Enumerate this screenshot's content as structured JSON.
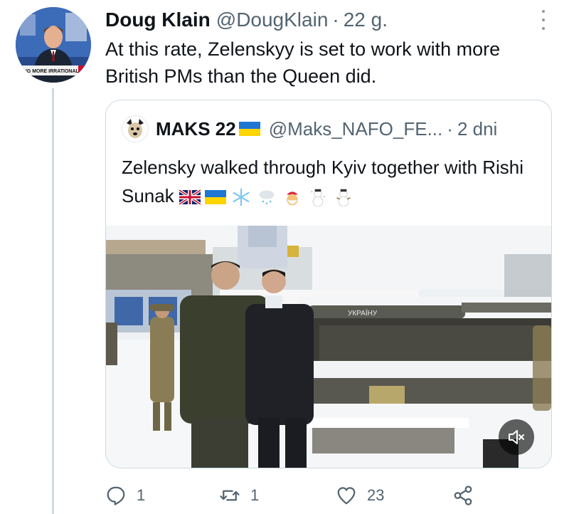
{
  "tweet": {
    "author": {
      "display_name": "Doug Klain",
      "handle": "@DougKlain",
      "avatar_banner_text": "MING MORE IRRATIONAL"
    },
    "separator": "·",
    "time": "22 g.",
    "text": "At this rate, Zelenskyy is set to work with more British PMs than the Queen did."
  },
  "quoted_tweet": {
    "author": {
      "display_name": "MAKS 22",
      "handle": "@Maks_NAFO_FE...",
      "flag_colors": [
        "#1f77d2",
        "#ffd500"
      ]
    },
    "separator": "·",
    "time": "2 dni",
    "text": "Zelensky walked through Kyiv together with Rishi Sunak",
    "emojis": [
      "uk-flag",
      "ukraine-flag",
      "snowflake",
      "cloud-with-snow",
      "santa",
      "snowman-with-snow",
      "snowman"
    ],
    "media_overlay_text": "УКРАЇНУ"
  },
  "actions": {
    "reply_count": "1",
    "retweet_count": "1",
    "like_count": "23"
  },
  "colors": {
    "text_primary": "#0f1419",
    "text_secondary": "#536471",
    "border": "#cfd9de"
  }
}
